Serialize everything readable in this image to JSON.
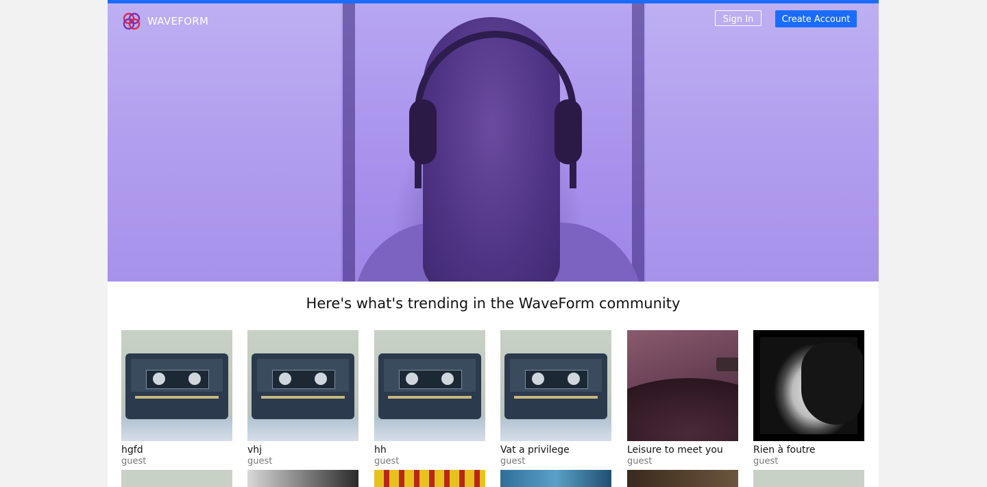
{
  "header": {
    "brand": "WAVEFORM",
    "sign_in_label": "Sign In",
    "create_account_label": "Create Account",
    "accent_color": "#1a6cff"
  },
  "hero": {
    "tint_color": "#a892ec"
  },
  "main": {
    "headline": "Here's what's trending in the WaveForm community",
    "tracks": [
      {
        "title": "hgfd",
        "user": "guest",
        "art": "cassette"
      },
      {
        "title": "vhj",
        "user": "guest",
        "art": "cassette"
      },
      {
        "title": "hh",
        "user": "guest",
        "art": "cassette"
      },
      {
        "title": "Vat a privilege",
        "user": "guest",
        "art": "cassette"
      },
      {
        "title": "Leisure to meet you",
        "user": "guest",
        "art": "vinyl"
      },
      {
        "title": "Rien à foutre",
        "user": "guest",
        "art": "portrait"
      }
    ]
  }
}
